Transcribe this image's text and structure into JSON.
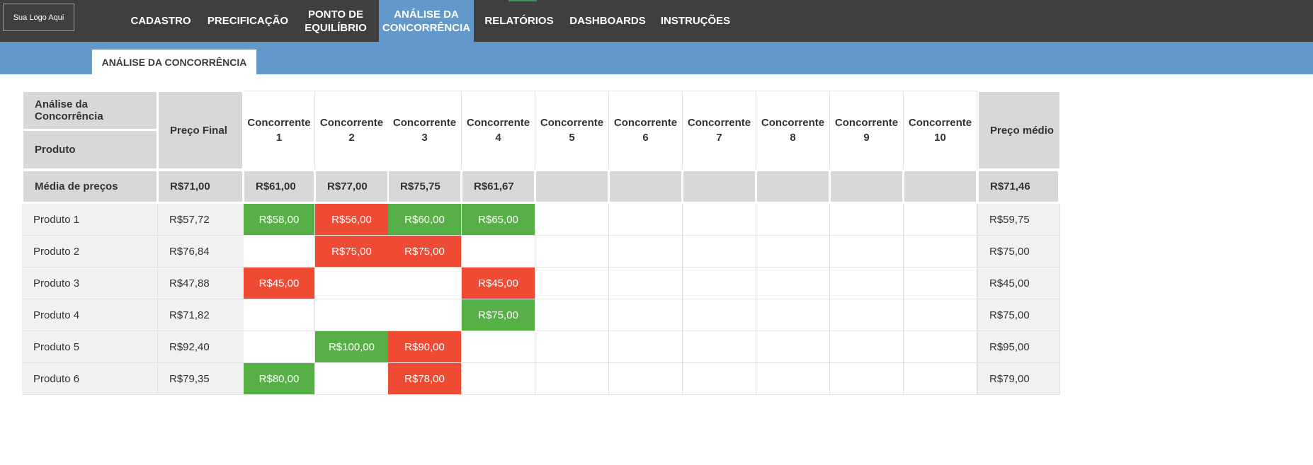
{
  "logo": "Sua Logo Aqui",
  "nav": [
    "CADASTRO",
    "PRECIFICAÇÃO",
    "PONTO DE\nEQUILÍBRIO",
    "ANÁLISE DA\nCONCORRÊNCIA",
    "RELATÓRIOS",
    "DASHBOARDS",
    "INSTRUÇÕES"
  ],
  "nav_active_index": 3,
  "subtab": "ANÁLISE DA CONCORRÊNCIA",
  "table": {
    "corner_top": "Análise da Concorrência",
    "corner_bottom": "Produto",
    "col_preco_final": "Preço Final",
    "competitors": [
      "Concorrente\n1",
      "Concorrente\n2",
      "Concorrente\n3",
      "Concorrente\n4",
      "Concorrente\n5",
      "Concorrente\n6",
      "Concorrente\n7",
      "Concorrente\n8",
      "Concorrente\n9",
      "Concorrente\n10"
    ],
    "col_avg": "Preço médio",
    "mean_row": {
      "label": "Média de preços",
      "final": "R$71,00",
      "competitors": [
        "R$61,00",
        "R$77,00",
        "R$75,75",
        "R$61,67",
        "",
        "",
        "",
        "",
        "",
        ""
      ],
      "avg": "R$71,46"
    },
    "rows": [
      {
        "name": "Produto 1",
        "final": "R$57,72",
        "competitors": [
          {
            "v": "R$58,00",
            "s": "green"
          },
          {
            "v": "R$56,00",
            "s": "red"
          },
          {
            "v": "R$60,00",
            "s": "green"
          },
          {
            "v": "R$65,00",
            "s": "green"
          },
          {
            "v": "",
            "s": ""
          },
          {
            "v": "",
            "s": ""
          },
          {
            "v": "",
            "s": ""
          },
          {
            "v": "",
            "s": ""
          },
          {
            "v": "",
            "s": ""
          },
          {
            "v": "",
            "s": ""
          }
        ],
        "avg": "R$59,75"
      },
      {
        "name": "Produto 2",
        "final": "R$76,84",
        "competitors": [
          {
            "v": "",
            "s": ""
          },
          {
            "v": "R$75,00",
            "s": "red"
          },
          {
            "v": "R$75,00",
            "s": "red"
          },
          {
            "v": "",
            "s": ""
          },
          {
            "v": "",
            "s": ""
          },
          {
            "v": "",
            "s": ""
          },
          {
            "v": "",
            "s": ""
          },
          {
            "v": "",
            "s": ""
          },
          {
            "v": "",
            "s": ""
          },
          {
            "v": "",
            "s": ""
          }
        ],
        "avg": "R$75,00"
      },
      {
        "name": "Produto 3",
        "final": "R$47,88",
        "competitors": [
          {
            "v": "R$45,00",
            "s": "red"
          },
          {
            "v": "",
            "s": ""
          },
          {
            "v": "",
            "s": ""
          },
          {
            "v": "R$45,00",
            "s": "red"
          },
          {
            "v": "",
            "s": ""
          },
          {
            "v": "",
            "s": ""
          },
          {
            "v": "",
            "s": ""
          },
          {
            "v": "",
            "s": ""
          },
          {
            "v": "",
            "s": ""
          },
          {
            "v": "",
            "s": ""
          }
        ],
        "avg": "R$45,00"
      },
      {
        "name": "Produto 4",
        "final": "R$71,82",
        "competitors": [
          {
            "v": "",
            "s": ""
          },
          {
            "v": "",
            "s": ""
          },
          {
            "v": "",
            "s": ""
          },
          {
            "v": "R$75,00",
            "s": "green"
          },
          {
            "v": "",
            "s": ""
          },
          {
            "v": "",
            "s": ""
          },
          {
            "v": "",
            "s": ""
          },
          {
            "v": "",
            "s": ""
          },
          {
            "v": "",
            "s": ""
          },
          {
            "v": "",
            "s": ""
          }
        ],
        "avg": "R$75,00"
      },
      {
        "name": "Produto 5",
        "final": "R$92,40",
        "competitors": [
          {
            "v": "",
            "s": ""
          },
          {
            "v": "R$100,00",
            "s": "green"
          },
          {
            "v": "R$90,00",
            "s": "red"
          },
          {
            "v": "",
            "s": ""
          },
          {
            "v": "",
            "s": ""
          },
          {
            "v": "",
            "s": ""
          },
          {
            "v": "",
            "s": ""
          },
          {
            "v": "",
            "s": ""
          },
          {
            "v": "",
            "s": ""
          },
          {
            "v": "",
            "s": ""
          }
        ],
        "avg": "R$95,00"
      },
      {
        "name": "Produto 6",
        "final": "R$79,35",
        "competitors": [
          {
            "v": "R$80,00",
            "s": "green"
          },
          {
            "v": "",
            "s": ""
          },
          {
            "v": "R$78,00",
            "s": "red"
          },
          {
            "v": "",
            "s": ""
          },
          {
            "v": "",
            "s": ""
          },
          {
            "v": "",
            "s": ""
          },
          {
            "v": "",
            "s": ""
          },
          {
            "v": "",
            "s": ""
          },
          {
            "v": "",
            "s": ""
          },
          {
            "v": "",
            "s": ""
          }
        ],
        "avg": "R$79,00"
      }
    ]
  },
  "colors": {
    "topbar": "#3f3f3f",
    "accent": "#6398ca",
    "above": "#56b046",
    "below": "#ef4b34",
    "header": "#d8d8d8"
  }
}
